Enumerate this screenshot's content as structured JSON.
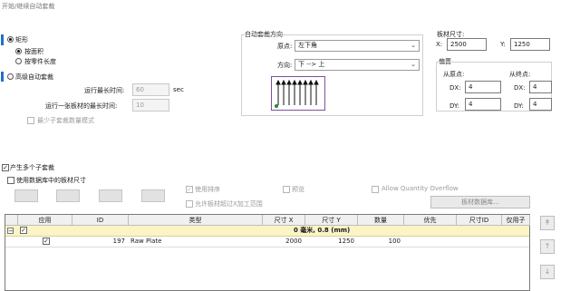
{
  "window": {
    "title": "开始/继续自动套裁"
  },
  "left": {
    "rect_option": "矩形",
    "by_area": "按面积",
    "by_part_length": "按零件长度",
    "advanced_option": "高级自动套裁",
    "max_run_time_label": "运行最长时间:",
    "max_run_time_value": "60",
    "max_run_time_unit": "sec",
    "max_run_one_label": "运行一张板材的最长时间:",
    "max_run_one_value": "10",
    "min_subnest_label": "最少子套裁数量模式"
  },
  "direction": {
    "group_label": "自动套裁方向",
    "origin_label": "原点:",
    "origin_value": "左下角",
    "direction_label": "方向:",
    "direction_value": "下 --> 上"
  },
  "sheet": {
    "size_label": "板材尺寸:",
    "x_label": "X:",
    "x_value": "2500",
    "y_label": "Y:",
    "y_value": "1250",
    "offset_label": "偏置",
    "from_origin_label": "从原点:",
    "from_end_label": "从终点:",
    "dx1_label": "DX:",
    "dx1_value": "4",
    "dy1_label": "DY:",
    "dy1_value": "4",
    "dx2_label": "DX:",
    "dx2_value": "4",
    "dy2_label": "DY:",
    "dy2_value": "4"
  },
  "multi": {
    "produce_multi_label": "产生多个子套裁",
    "use_db_sheet_label": "使用数据库中的板材尺寸",
    "use_sort_label": "使用排序",
    "preview_label": "预览",
    "allow_overflow_label": "Allow Quantity Overflow",
    "allow_exceed_label": "允许板材超过X加工范围",
    "sheet_db_button": "板材数据库..."
  },
  "table": {
    "headers": [
      "应用",
      "ID",
      "类型",
      "尺寸 X",
      "尺寸 Y",
      "数量",
      "优先",
      "尺寸ID",
      "仅用子"
    ],
    "group_row": "0  毫米, 0.8 (mm)",
    "rows": [
      {
        "id": "197",
        "type": "Raw Plate",
        "size_x": "2000",
        "size_y": "1250",
        "qty": "100"
      }
    ]
  }
}
